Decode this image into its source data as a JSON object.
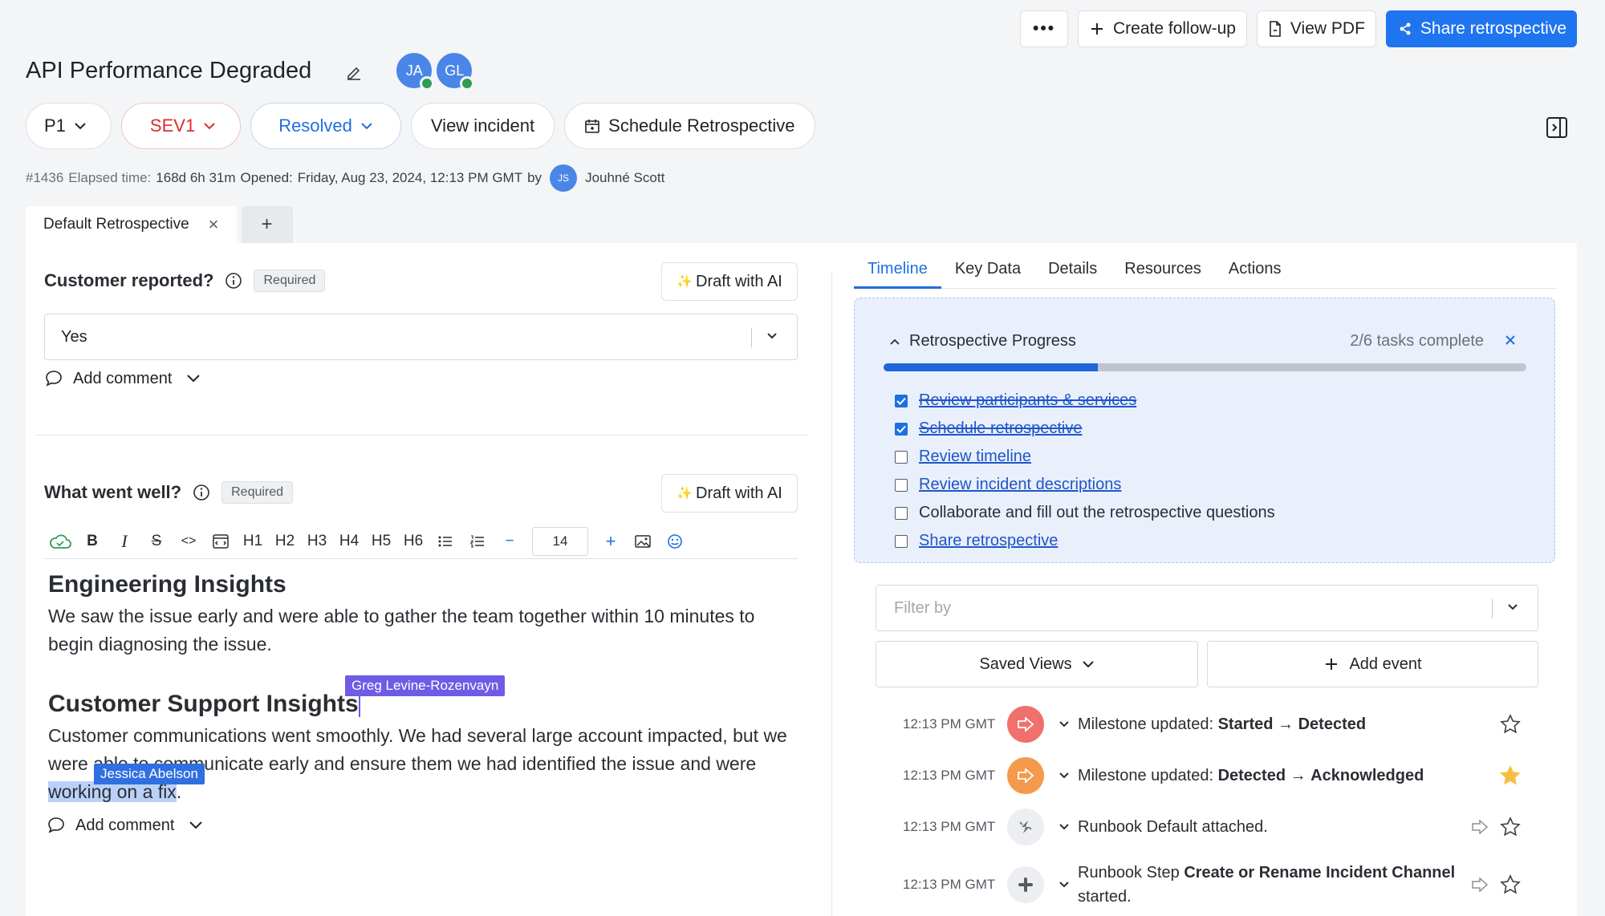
{
  "header": {
    "more_label": "•••",
    "create_followup_label": "Create follow-up",
    "view_pdf_label": "View PDF",
    "share_label": "Share retrospective"
  },
  "incident": {
    "title": "API Performance Degraded",
    "avatars": [
      "JA",
      "GL"
    ],
    "priority": "P1",
    "severity": "SEV1",
    "status": "Resolved",
    "view_incident_label": "View incident",
    "schedule_label": "Schedule Retrospective",
    "number": "#1436",
    "elapsed_label": "Elapsed time:",
    "elapsed_value": "168d 6h 31m",
    "opened_label": "Opened:",
    "opened_value": "Friday, Aug 23, 2024, 12:13 PM GMT",
    "by_label": "by",
    "owner_initials": "JS",
    "owner_name": "Jouhné Scott"
  },
  "doc_tabs": {
    "active": "Default Retrospective",
    "close": "×",
    "add": "+"
  },
  "questions": {
    "q1": {
      "label": "Customer reported?",
      "badge": "Required",
      "draft_label": "Draft with AI",
      "draft_icon": "✨",
      "value": "Yes",
      "comment_label": "Add comment"
    },
    "q2": {
      "label": "What went well?",
      "badge": "Required",
      "draft_label": "Draft with AI",
      "draft_icon": "✨",
      "comment_label": "Add comment"
    }
  },
  "toolbar": {
    "bold": "B",
    "italic": "I",
    "strike": "S",
    "code": "<>",
    "headings": [
      "H1",
      "H2",
      "H3",
      "H4",
      "H5",
      "H6"
    ],
    "minus": "−",
    "font_size": "14",
    "plus": "+"
  },
  "editor": {
    "h_engineering": "Engineering Insights",
    "p_engineering": "We saw the issue early and were able to gather the team together within 10 minutes to begin diagnosing the issue.",
    "h_support": "Customer Support Insights",
    "p_support_1": "Customer communications went smoothly. We had several large account impacted, but we were able to communicate early and ensure them we had identified the issue and were ",
    "p_support_hl": "working on a fix",
    "p_support_end": ".",
    "cursor_greg": "Greg Levine-Rozenvayn",
    "cursor_jessica": "Jessica Abelson"
  },
  "right_tabs": [
    "Timeline",
    "Key Data",
    "Details",
    "Resources",
    "Actions"
  ],
  "progress": {
    "title": "Retrospective Progress",
    "count": "2/6 tasks complete",
    "completed": 2,
    "total": 6,
    "tasks": [
      {
        "label": "Review participants & services",
        "done": true,
        "link": true
      },
      {
        "label": "Schedule retrospective",
        "done": true,
        "link": true
      },
      {
        "label": "Review timeline",
        "done": false,
        "link": true
      },
      {
        "label": "Review incident descriptions",
        "done": false,
        "link": true
      },
      {
        "label": "Collaborate and fill out the retrospective questions",
        "done": false,
        "link": false
      },
      {
        "label": "Share retrospective",
        "done": false,
        "link": true
      }
    ]
  },
  "timeline": {
    "filter_placeholder": "Filter by",
    "saved_views_label": "Saved Views",
    "add_event_label": "Add event",
    "events": [
      {
        "time": "12:13 PM GMT",
        "text_pre": "Milestone updated: ",
        "b1": "Started",
        "arrow": "→",
        "b2": "Detected",
        "starred": false
      },
      {
        "time": "12:13 PM GMT",
        "text_pre": "Milestone updated: ",
        "b1": "Detected",
        "arrow": "→",
        "b2": "Acknowledged",
        "starred": true
      },
      {
        "time": "12:13 PM GMT",
        "text": "Runbook Default attached.",
        "starred": false
      },
      {
        "time": "12:13 PM GMT",
        "text_pre": "Runbook Step ",
        "b1": "Create or Rename Incident Channel",
        "text_post": "started.",
        "starred": false
      }
    ]
  },
  "colors": {
    "accent": "#1f74f0",
    "severity": "#d92d2d",
    "milestone_started": "#f0706e",
    "milestone_detected": "#f59a4d",
    "star_active": "#f5c042",
    "cursor_greg": "#6e5ce6",
    "cursor_jessica": "#2f6fe0"
  }
}
